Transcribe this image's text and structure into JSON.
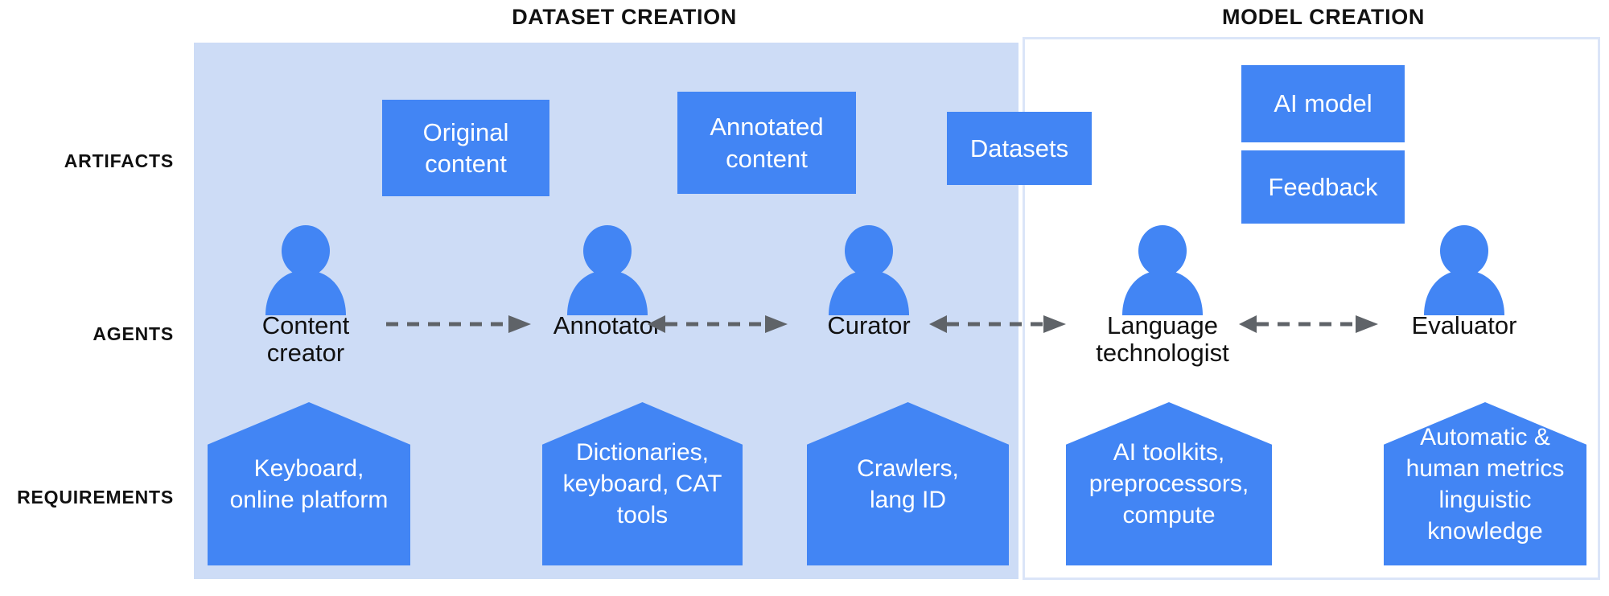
{
  "sections": {
    "dataset_creation": "DATASET CREATION",
    "model_creation": "MODEL CREATION"
  },
  "row_labels": {
    "artifacts": "ARTIFACTS",
    "agents": "AGENTS",
    "requirements": "REQUIREMENTS"
  },
  "colors": {
    "panel_dataset_bg": "#cddcf6",
    "panel_model_border": "#dbe5f8",
    "box_blue": "#4285f4",
    "arrow_gray": "#5f6368",
    "text_dark": "#111111",
    "text_light": "#ffffff"
  },
  "artifacts": [
    {
      "id": "original-content",
      "label": "Original\ncontent",
      "section": "dataset"
    },
    {
      "id": "annotated-content",
      "label": "Annotated\ncontent",
      "section": "dataset"
    },
    {
      "id": "datasets",
      "label": "Datasets",
      "section": "dataset"
    },
    {
      "id": "ai-model",
      "label": "AI model",
      "section": "model"
    },
    {
      "id": "feedback",
      "label": "Feedback",
      "section": "model"
    }
  ],
  "agents": [
    {
      "id": "content-creator",
      "label": "Content\ncreator",
      "icon": "person-icon",
      "section": "dataset"
    },
    {
      "id": "annotator",
      "label": "Annotator",
      "icon": "person-icon",
      "section": "dataset"
    },
    {
      "id": "curator",
      "label": "Curator",
      "icon": "person-icon",
      "section": "dataset"
    },
    {
      "id": "language-technologist",
      "label": "Language\ntechnologist",
      "icon": "person-icon",
      "section": "model"
    },
    {
      "id": "evaluator",
      "label": "Evaluator",
      "icon": "person-icon",
      "section": "model"
    }
  ],
  "arrows": [
    {
      "id": "content-creator-to-annotator",
      "style": "dashed",
      "direction": "right"
    },
    {
      "id": "annotator-curator",
      "style": "dashed",
      "direction": "both"
    },
    {
      "id": "curator-language-technologist",
      "style": "dashed",
      "direction": "both"
    },
    {
      "id": "language-technologist-evaluator",
      "style": "dashed",
      "direction": "both"
    }
  ],
  "requirements": [
    {
      "id": "content-creator-requirements",
      "label": "Keyboard,\nonline platform",
      "section": "dataset"
    },
    {
      "id": "annotator-requirements",
      "label": "Dictionaries,\nkeyboard, CAT\ntools",
      "section": "dataset"
    },
    {
      "id": "curator-requirements",
      "label": "Crawlers,\nlang ID",
      "section": "dataset"
    },
    {
      "id": "language-technologist-requirements",
      "label": "AI toolkits,\npreprocessors,\ncompute",
      "section": "model"
    },
    {
      "id": "evaluator-requirements",
      "label": "Automatic &\nhuman metrics\nlinguistic\nknowledge",
      "section": "model"
    }
  ]
}
